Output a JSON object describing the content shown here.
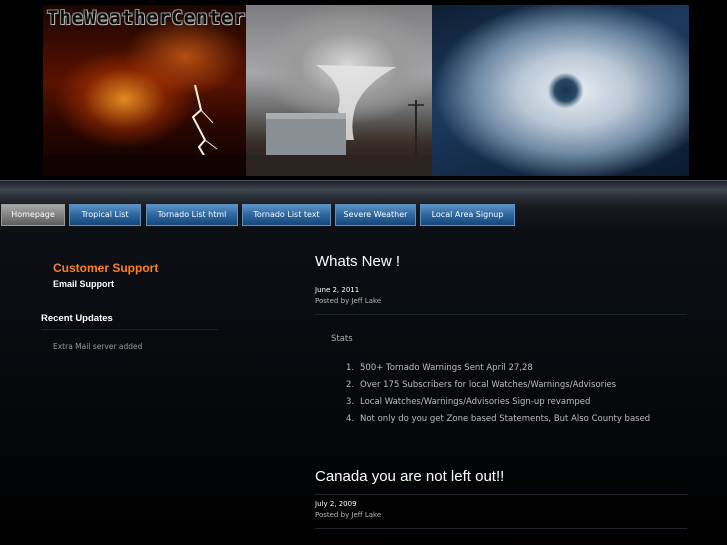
{
  "header": {
    "site_title": "TheWeatherCenter",
    "banner_images": [
      "lightning-storm-image",
      "tornado-image",
      "hurricane-satellite-image"
    ]
  },
  "nav": {
    "tabs": [
      {
        "label": "Homepage",
        "active": true
      },
      {
        "label": "Tropical List",
        "active": false
      },
      {
        "label": "Tornado List html",
        "active": false
      },
      {
        "label": "Tornado List text",
        "active": false
      },
      {
        "label": "Severe Weather",
        "active": false
      },
      {
        "label": "Local Area Signup",
        "active": false
      }
    ]
  },
  "sidebar": {
    "support_heading": "Customer Support",
    "email_support": "Email Support",
    "recent_heading": "Recent Updates",
    "recent_items": [
      "Extra Mail server added"
    ]
  },
  "posts": [
    {
      "title": "Whats New !",
      "date": "June 2, 2011",
      "author": "Posted by Jeff Lake",
      "stats_label": "Stats",
      "stats": [
        {
          "num": "1.",
          "text": "500+ Tornado Warnings Sent April 27,28"
        },
        {
          "num": "2.",
          "text": "Over 175 Subscribers for local Watches/Warnings/Advisories"
        },
        {
          "num": "3.",
          "text": "Local Watches/Warnings/Advisories Sign-up revamped"
        },
        {
          "num": "4.",
          "text": "Not only do you get Zone based Statements, But Also County based"
        }
      ]
    },
    {
      "title": "Canada you are not left out!!",
      "date": "July 2, 2009",
      "author": "Posted by Jeff Lake"
    }
  ],
  "colors": {
    "accent_orange": "#ff7f1d",
    "tab_blue": "#2f6aa3",
    "tab_active_gray": "#7e7e7e",
    "background": "#000000"
  }
}
